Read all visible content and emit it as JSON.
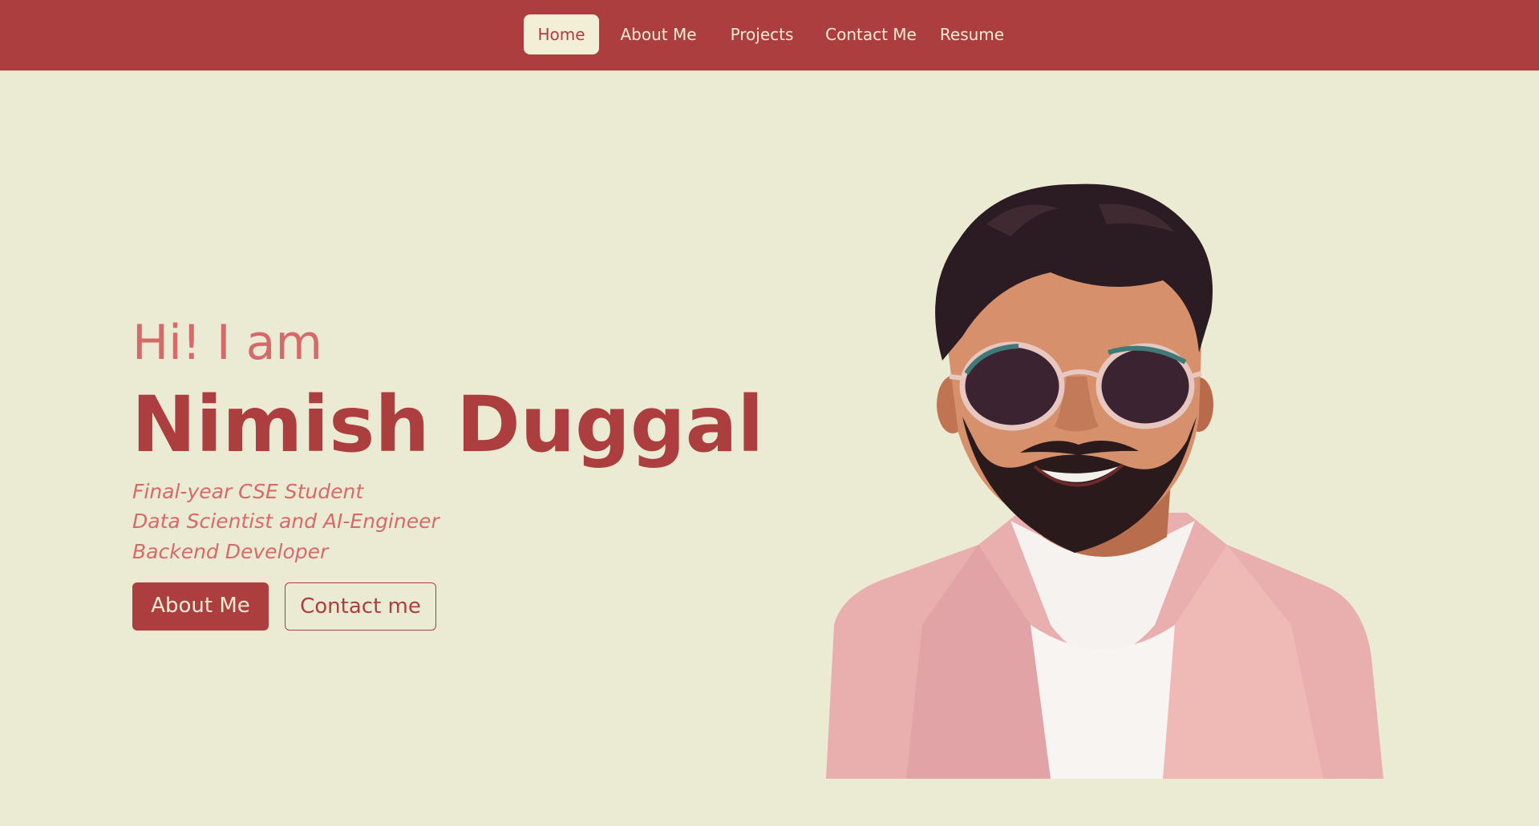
{
  "nav": {
    "items": [
      {
        "label": "Home",
        "active": true
      },
      {
        "label": "About Me",
        "active": false
      },
      {
        "label": "Projects",
        "active": false
      },
      {
        "label": "Contact Me",
        "active": false
      },
      {
        "label": "Resume",
        "active": false
      }
    ]
  },
  "hero": {
    "greeting": "Hi! I am",
    "name": "Nimish Duggal",
    "taglines": [
      "Final-year CSE Student",
      "Data Scientist and AI-Engineer",
      "Backend Developer"
    ],
    "buttons": {
      "about": "About Me",
      "contact": "Contact me"
    }
  },
  "colors": {
    "accent": "#ad3e3f",
    "background": "#ebebd3",
    "soft_accent": "#d66a6a",
    "nav_text": "#f4ebd3"
  }
}
